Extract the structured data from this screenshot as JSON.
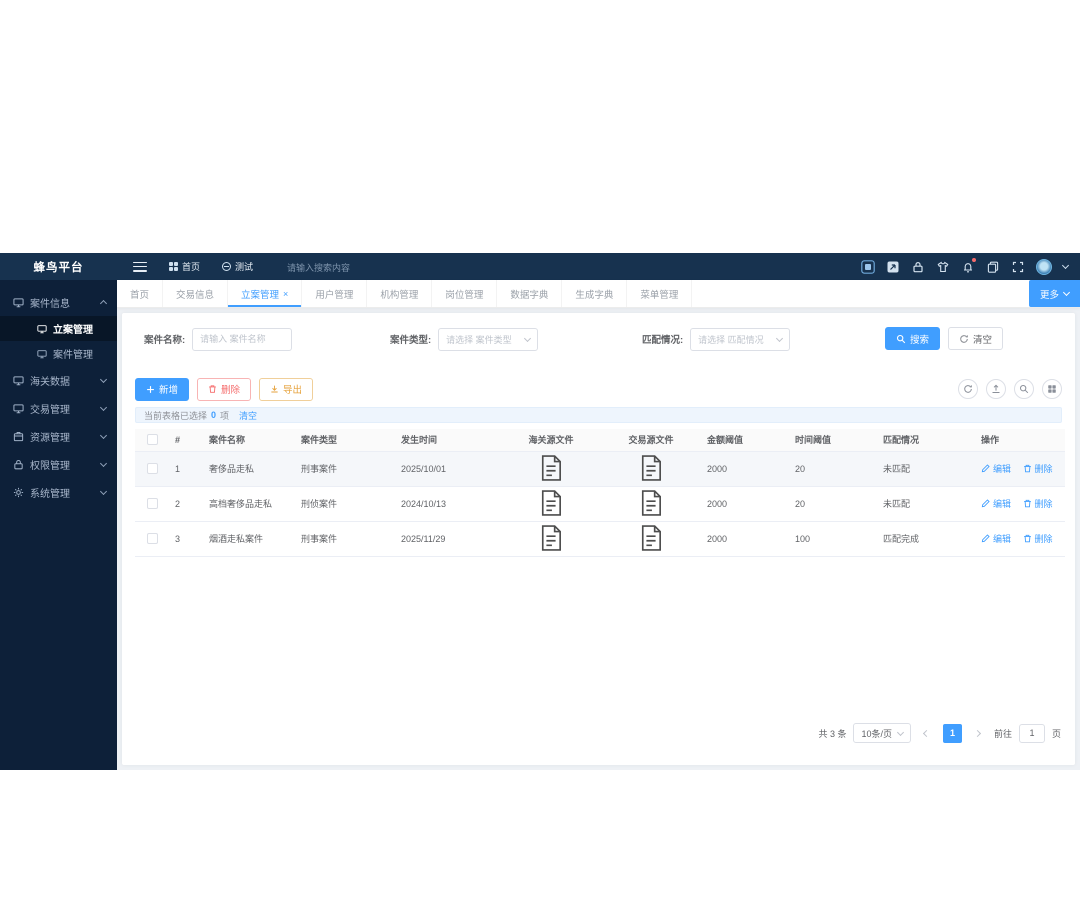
{
  "colors": {
    "accent": "#409eff",
    "danger": "#f56c6c",
    "warning": "#e6a23c",
    "topbar_bg": "#17324f",
    "sidebar_bg": "#0d2039"
  },
  "topbar": {
    "logo": "蜂鸟平台",
    "nav_home": "首页",
    "nav_test": "测试",
    "search_placeholder": "请输入搜索内容",
    "right_icons": [
      "monitor-icon",
      "screenshot-icon",
      "lock-icon",
      "theme-icon",
      "notification-bell-icon",
      "documents-icon",
      "fullscreen-icon",
      "avatar",
      "chevron-down-icon"
    ]
  },
  "sidebar": {
    "groups": [
      {
        "label": "案件信息"
      },
      {
        "label": "海关数据"
      },
      {
        "label": "交易管理"
      },
      {
        "label": "资源管理"
      },
      {
        "label": "权限管理"
      },
      {
        "label": "系统管理"
      }
    ],
    "children": [
      {
        "label": "立案管理"
      },
      {
        "label": "案件管理"
      }
    ]
  },
  "tabs": {
    "items": [
      {
        "label": "首页"
      },
      {
        "label": "交易信息"
      },
      {
        "label": "立案管理"
      },
      {
        "label": "用户管理"
      },
      {
        "label": "机构管理"
      },
      {
        "label": "岗位管理"
      },
      {
        "label": "数据字典"
      },
      {
        "label": "生成字典"
      },
      {
        "label": "菜单管理"
      }
    ],
    "close": "×",
    "more": "更多"
  },
  "filters": {
    "name_label": "案件名称:",
    "name_placeholder": "请输入 案件名称",
    "type_label": "案件类型:",
    "type_placeholder": "请选择 案件类型",
    "match_label": "匹配情况:",
    "match_placeholder": "请选择 匹配情况",
    "search": "搜索",
    "clear": "清空"
  },
  "toolbar": {
    "add": "新增",
    "remove": "删除",
    "export": "导出"
  },
  "selection": {
    "prefix": "当前表格已选择",
    "count": "0",
    "unit": "项",
    "clear": "清空"
  },
  "table": {
    "columns": {
      "index": "#",
      "name": "案件名称",
      "type": "案件类型",
      "date": "发生时间",
      "customs_file": "海关源文件",
      "trade_file": "交易源文件",
      "amount": "金额阈值",
      "time": "时间阈值",
      "match": "匹配情况",
      "ops": "操作"
    },
    "rows": [
      {
        "index": "1",
        "name": "奢侈品走私",
        "type": "刑事案件",
        "date": "2025/10/01",
        "amount": "2000",
        "time": "20",
        "match": "未匹配"
      },
      {
        "index": "2",
        "name": "高档奢侈品走私",
        "type": "刑侦案件",
        "date": "2024/10/13",
        "amount": "2000",
        "time": "20",
        "match": "未匹配"
      },
      {
        "index": "3",
        "name": "烟酒走私案件",
        "type": "刑事案件",
        "date": "2025/11/29",
        "amount": "2000",
        "time": "100",
        "match": "匹配完成"
      }
    ],
    "ops": {
      "edit": "编辑",
      "remove": "删除"
    }
  },
  "pagination": {
    "total": "共 3 条",
    "size": "10条/页",
    "page": "1",
    "goto": "前往",
    "goto_value": "1",
    "unit": "页"
  }
}
